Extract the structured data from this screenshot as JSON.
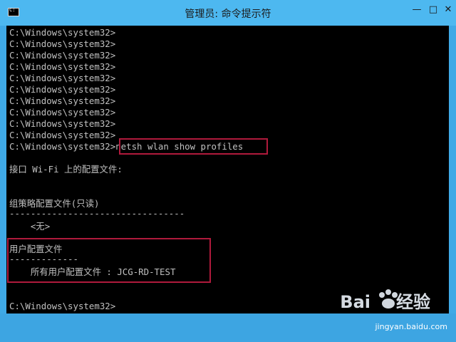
{
  "window": {
    "title": "管理员: 命令提示符",
    "controls": {
      "minimize": "—",
      "maximize": "□",
      "close": "✕"
    }
  },
  "console": {
    "lines": [
      "C:\\Windows\\system32>",
      "C:\\Windows\\system32>",
      "C:\\Windows\\system32>",
      "C:\\Windows\\system32>",
      "C:\\Windows\\system32>",
      "C:\\Windows\\system32>",
      "C:\\Windows\\system32>",
      "C:\\Windows\\system32>",
      "C:\\Windows\\system32>",
      "C:\\Windows\\system32>",
      "C:\\Windows\\system32>netsh wlan show profiles",
      "",
      "接口 Wi-Fi 上的配置文件:",
      "",
      "",
      "组策略配置文件(只读)",
      "---------------------------------",
      "    <无>",
      "",
      "用户配置文件",
      "-------------",
      "    所有用户配置文件 : JCG-RD-TEST",
      "",
      "",
      "C:\\Windows\\system32>"
    ]
  },
  "watermark": {
    "brand": "Bai",
    "brand_suffix": "经验",
    "url": "jingyan.baidu.com"
  },
  "colors": {
    "highlight_box": "#b01a3c",
    "titlebar": "#4db8f0",
    "console_bg": "#000000",
    "console_text": "#c0c0c0"
  }
}
